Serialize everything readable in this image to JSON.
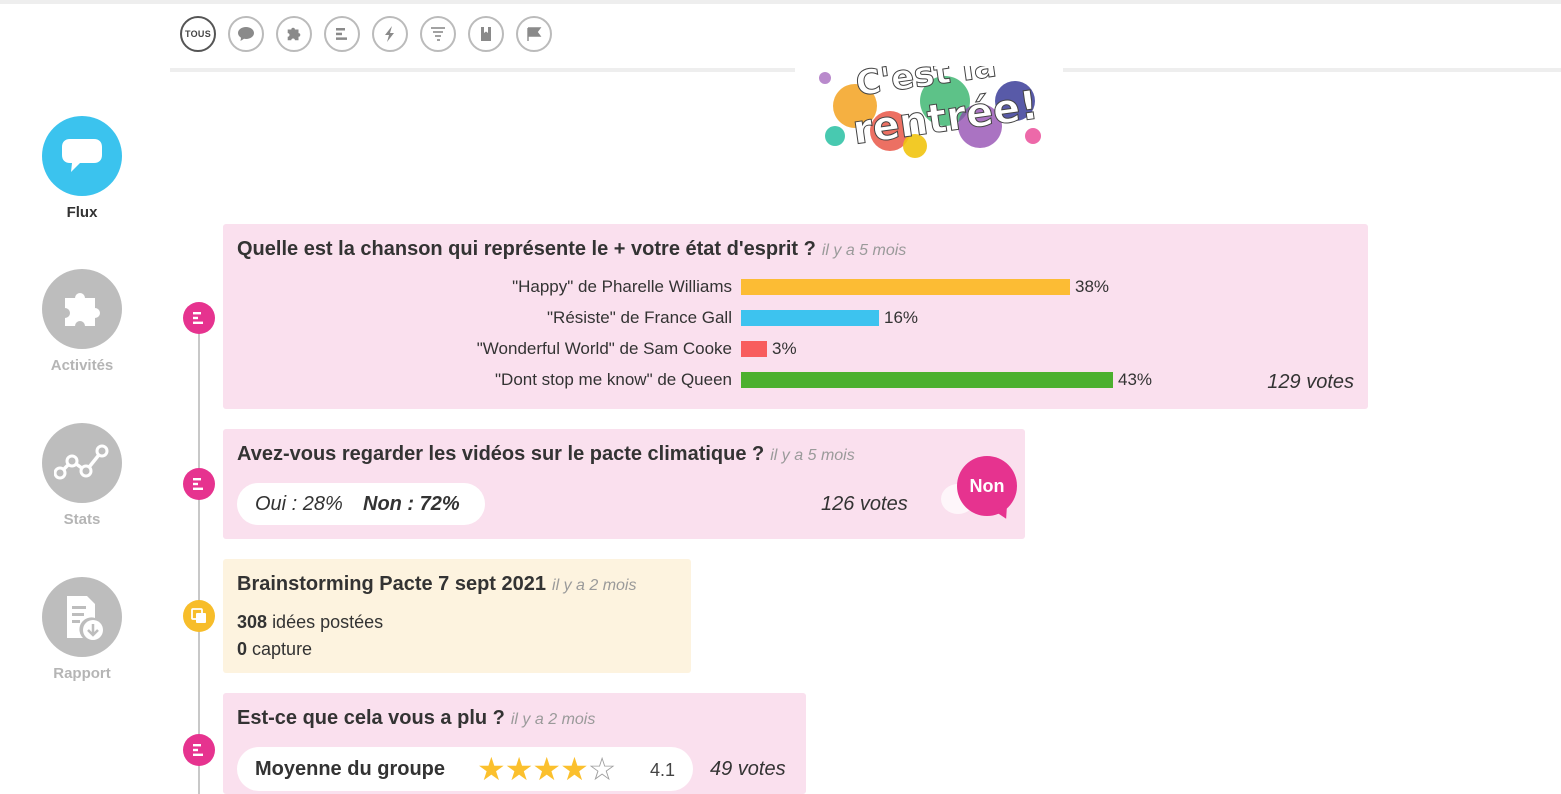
{
  "filters": [
    {
      "label": "TOUS",
      "icon": "tous"
    },
    {
      "label": "",
      "icon": "speech-bubble-icon"
    },
    {
      "label": "",
      "icon": "puzzle-icon"
    },
    {
      "label": "",
      "icon": "poll-icon"
    },
    {
      "label": "",
      "icon": "lightning-icon"
    },
    {
      "label": "",
      "icon": "tornado-icon"
    },
    {
      "label": "",
      "icon": "bookmark-icon"
    },
    {
      "label": "",
      "icon": "flag-icon"
    }
  ],
  "sidebar": {
    "items": [
      {
        "label": "Flux",
        "icon": "speech-bubble-icon",
        "active": true
      },
      {
        "label": "Activités",
        "icon": "puzzle-icon",
        "active": false
      },
      {
        "label": "Stats",
        "icon": "stats-line-icon",
        "active": false
      },
      {
        "label": "Rapport",
        "icon": "report-download-icon",
        "active": false
      }
    ]
  },
  "banner": {
    "line1": "C'est la",
    "line2": "rentrée!"
  },
  "cards": [
    {
      "title": "Quelle est la chanson qui représente le + votre état d'esprit ?",
      "ago": "il y a 5 mois",
      "options": [
        {
          "label": "\"Happy\" de Pharelle Williams",
          "pct": "38%",
          "value": 38,
          "color": "#fcbc34"
        },
        {
          "label": "\"Résiste\" de France Gall",
          "pct": "16%",
          "value": 16,
          "color": "#3dc3ef"
        },
        {
          "label": "\"Wonderful World\" de Sam Cooke",
          "pct": "3%",
          "value": 3,
          "color": "#f85d5d"
        },
        {
          "label": "\"Dont stop me know\" de Queen",
          "pct": "43%",
          "value": 43,
          "color": "#4cb02f"
        }
      ],
      "votes": "129 votes"
    },
    {
      "title": "Avez-vous regarder les vidéos sur le pacte climatique ?",
      "ago": "il y a 5 mois",
      "oui": "Oui : 28%",
      "non": "Non : 72%",
      "votes": "126 votes",
      "badge": "Non"
    },
    {
      "title": "Brainstorming Pacte 7 sept 2021",
      "ago": "il y a 2 mois",
      "ideas_count": "308",
      "ideas_label": "idées postées",
      "capture_count": "0",
      "capture_label": "capture"
    },
    {
      "title": "Est-ce que cela vous a plu ?",
      "ago": "il y a 2 mois",
      "avg_label": "Moyenne du groupe",
      "rating": "4.1",
      "rating_value": 4.1,
      "stars_max": 5,
      "votes": "49 votes"
    }
  ],
  "colors": {
    "accent_blue": "#3bc3ee",
    "pink": "#e6338f",
    "yellow": "#f7bd2a",
    "card_pink": "#fae0ee",
    "card_cream": "#fdf3df"
  }
}
